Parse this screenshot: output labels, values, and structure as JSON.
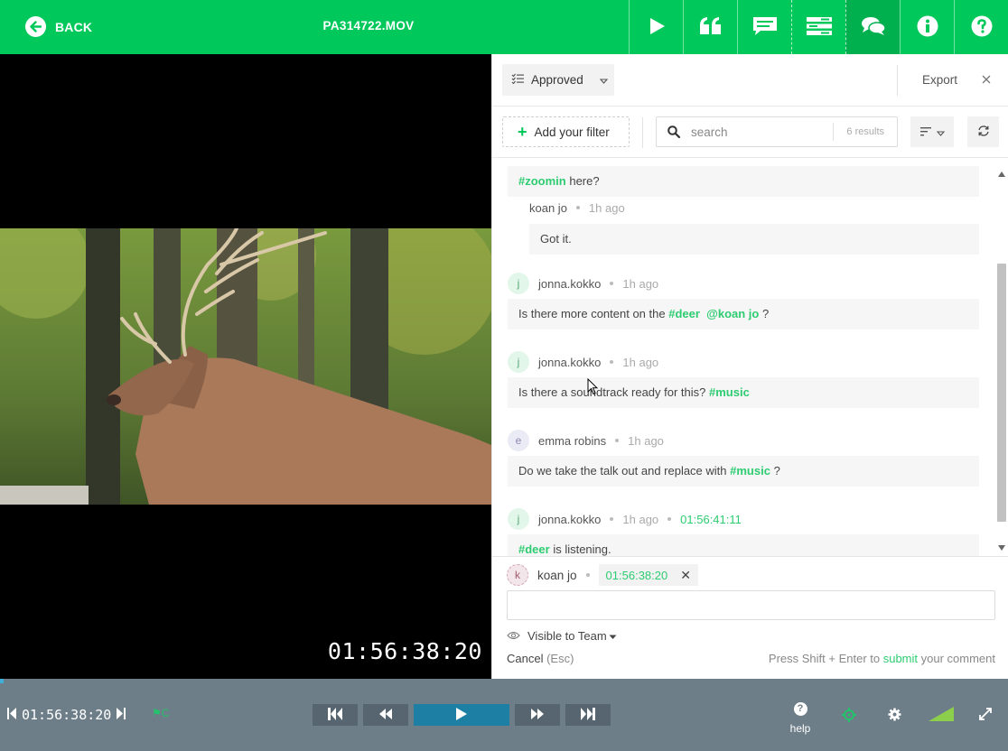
{
  "topbar": {
    "back_label": "BACK",
    "file_name": "PA314722.MOV",
    "icons": [
      "play-icon",
      "quote-icon",
      "comment-icon",
      "list-icon",
      "chat-icon",
      "info-icon",
      "help-icon"
    ],
    "color": "#00c85a"
  },
  "video": {
    "timecode": "01:56:38:20"
  },
  "panel": {
    "status_label": "Approved",
    "export_label": "Export",
    "add_filter_label": "Add your filter",
    "search_placeholder": "search",
    "results_label": "6 results"
  },
  "comments": [
    {
      "body_prefix": "",
      "tags": [
        "#zoomin"
      ],
      "body_suffix": " here?"
    },
    {
      "author": "koan jo",
      "time": "1h ago",
      "body": "Got it."
    },
    {
      "author": "jonna.kokko",
      "initial": "j",
      "time": "1h ago",
      "body_prefix": "Is there more content on the ",
      "tag1": "#deer",
      "tag2": "@koan jo",
      "body_suffix": " ?"
    },
    {
      "author": "jonna.kokko",
      "initial": "j",
      "time": "1h ago",
      "body_prefix": "Is there a soundtrack ready for this? ",
      "tag1": "#music"
    },
    {
      "author": "emma robins",
      "initial": "e",
      "time": "1h ago",
      "body_prefix": "Do we take the talk out and replace with ",
      "tag1": "#music",
      "body_suffix": " ?"
    },
    {
      "author": "jonna.kokko",
      "initial": "j",
      "time": "1h ago",
      "timecode": "01:56:41:11",
      "tag1": "#deer",
      "body_suffix": " is listening."
    }
  ],
  "composer": {
    "author": "koan jo",
    "initial": "k",
    "timecode": "01:56:38:20",
    "visibility_label": "Visible to Team",
    "cancel_label": "Cancel",
    "cancel_hint": "(Esc)",
    "hint_prefix": "Press Shift + Enter to ",
    "hint_submit": "submit",
    "hint_suffix": " your comment"
  },
  "player": {
    "timecode": "01:56:38:20",
    "flag_label": "⚑C",
    "help_label": "help",
    "help_glyph": "?",
    "accent": "#1e7fa4"
  }
}
